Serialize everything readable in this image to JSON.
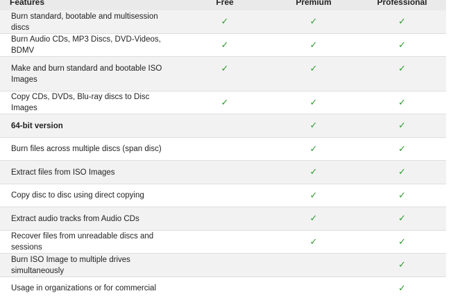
{
  "header": {
    "feature": "Features",
    "free": "Free",
    "premium": "Premium",
    "professional": "Professional"
  },
  "check_symbol": "✓",
  "check_color": "#2e9a2e",
  "rows": [
    {
      "label": "Burn standard, bootable and multisession discs",
      "free": true,
      "premium": true,
      "professional": true,
      "bold": false
    },
    {
      "label": "Burn Audio CDs, MP3 Discs, DVD-Videos, BDMV",
      "free": true,
      "premium": true,
      "professional": true,
      "bold": false
    },
    {
      "label": "Make and burn standard and bootable ISO Images",
      "free": true,
      "premium": true,
      "professional": true,
      "bold": false
    },
    {
      "label": "Copy CDs, DVDs, Blu-ray discs to Disc Images",
      "free": true,
      "premium": true,
      "professional": true,
      "bold": false
    },
    {
      "label": "64-bit version",
      "free": false,
      "premium": true,
      "professional": true,
      "bold": true
    },
    {
      "label": "Burn files across multiple discs (span disc)",
      "free": false,
      "premium": true,
      "professional": true,
      "bold": false
    },
    {
      "label": "Extract files from ISO Images",
      "free": false,
      "premium": true,
      "professional": true,
      "bold": false
    },
    {
      "label": "Copy disc to disc using direct copying",
      "free": false,
      "premium": true,
      "professional": true,
      "bold": false
    },
    {
      "label": "Extract audio tracks from Audio CDs",
      "free": false,
      "premium": true,
      "professional": true,
      "bold": false
    },
    {
      "label": "Recover files from unreadable discs and sessions",
      "free": false,
      "premium": true,
      "professional": true,
      "bold": false
    },
    {
      "label": "Burn ISO Image to multiple drives simultaneously",
      "free": false,
      "premium": false,
      "professional": true,
      "bold": false
    },
    {
      "label": "Usage in organizations or for commercial",
      "free": false,
      "premium": false,
      "professional": true,
      "bold": false
    }
  ]
}
